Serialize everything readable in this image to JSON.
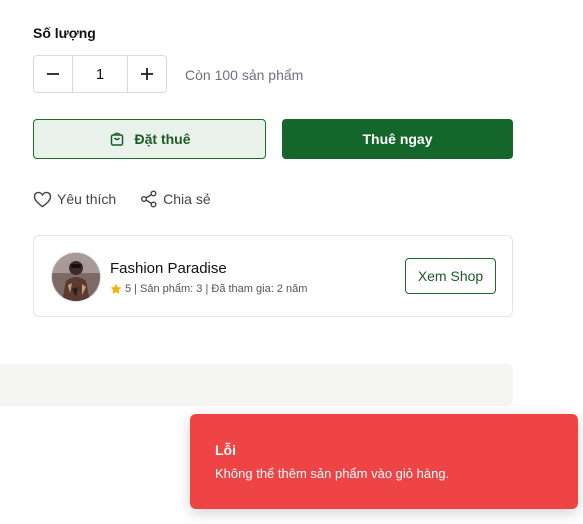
{
  "quantity": {
    "label": "Số lượng",
    "value": "1",
    "decrement_icon": "minus-icon",
    "increment_icon": "plus-icon",
    "stock_text": "Còn 100 sản phẩm"
  },
  "buttons": {
    "rent_label": "Đặt thuê",
    "rent_icon": "shopping-bag-icon",
    "buy_label": "Thuê ngay"
  },
  "actions": {
    "favorite_label": "Yêu thích",
    "favorite_icon": "heart-icon",
    "share_label": "Chia sẻ",
    "share_icon": "share-icon"
  },
  "shop": {
    "name": "Fashion Paradise",
    "rating": "5",
    "meta": "| Sản phẩm: 3 | Đã tham gia: 2 năm",
    "view_label": "Xem Shop",
    "star_color": "#f5b301"
  },
  "toast": {
    "title": "Lỗi",
    "message": "Không thể thêm sản phẩm vào giỏ hàng.",
    "color": "#ef4446"
  },
  "colors": {
    "primary": "#14662a",
    "primary_light": "#e8f1ea"
  }
}
